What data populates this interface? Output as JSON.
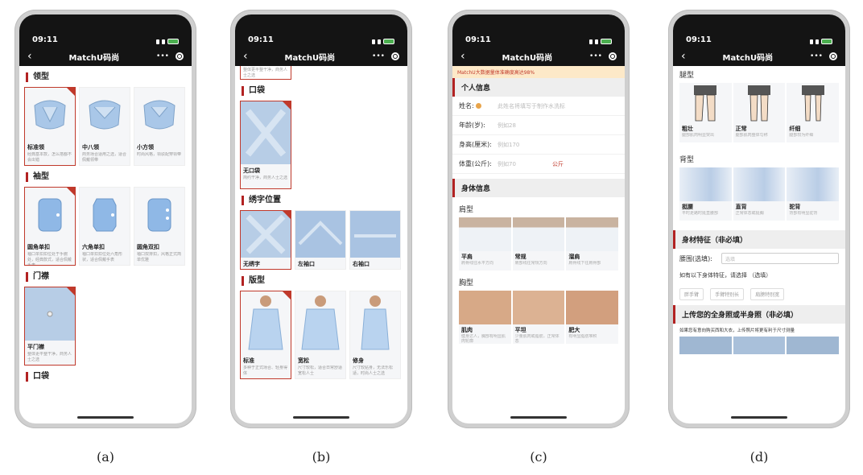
{
  "status": {
    "time": "09:11"
  },
  "nav": {
    "title": "MatchU码尚",
    "back": "‹",
    "more": "•••"
  },
  "captions": [
    "(a)",
    "(b)",
    "(c)",
    "(d)"
  ],
  "screen_a": {
    "sections": [
      {
        "title": "领型",
        "options": [
          {
            "name": "标准领",
            "desc": "经典基本款，怎么搭都不会出错",
            "selected": true
          },
          {
            "name": "中八领",
            "desc": "商务场合适用之选，适合佩戴领带",
            "selected": false
          },
          {
            "name": "小方领",
            "desc": "时尚风格，领驳配穿领带",
            "selected": false
          }
        ]
      },
      {
        "title": "袖型",
        "options": [
          {
            "name": "圆角单扣",
            "desc": "袖口单扣扣位处于手腕处，经典款式，适合佩戴手表",
            "selected": true
          },
          {
            "name": "六角单扣",
            "desc": "袖口单扣扣位处六角形状，适合佩戴手表",
            "selected": false
          },
          {
            "name": "圆角双扣",
            "desc": "袖口双排扣，风格正式简单优雅",
            "selected": false
          }
        ]
      },
      {
        "title": "门襟",
        "options": [
          {
            "name": "平门襟",
            "desc": "整体更平整干净，商务人士之选",
            "selected": true
          }
        ]
      }
    ],
    "last_title": "口袋"
  },
  "screen_b": {
    "top_desc": "整体更平整干净，商务人士之选",
    "sections": [
      {
        "title": "口袋",
        "options": [
          {
            "name": "无口袋",
            "desc": "简约干净，商务人士之选",
            "selected": true
          }
        ]
      },
      {
        "title": "绣字位置",
        "options": [
          {
            "name": "无绣字",
            "desc": "",
            "selected": true
          },
          {
            "name": "左袖口",
            "desc": "",
            "selected": false
          },
          {
            "name": "右袖口",
            "desc": "",
            "selected": false
          }
        ]
      },
      {
        "title": "版型",
        "options": [
          {
            "name": "标准",
            "desc": "多种于正式场合、轻身得体",
            "selected": true
          },
          {
            "name": "宽松",
            "desc": "尺寸较松，适合日常舒适宽松人士",
            "selected": false
          },
          {
            "name": "修身",
            "desc": "尺寸较贴身，无法乐松适，时尚人士之选",
            "selected": false
          }
        ]
      }
    ]
  },
  "screen_c": {
    "banner": "MatchU大数据量体准确度高达98%",
    "personal_title": "个人信息",
    "fields": [
      {
        "label": "姓名:",
        "placeholder": "此姓名将填写于制作水洗标",
        "unit": ""
      },
      {
        "label": "年龄(岁):",
        "placeholder": "例如28",
        "unit": ""
      },
      {
        "label": "身高(厘米):",
        "placeholder": "例如170",
        "unit": ""
      },
      {
        "label": "体重(公斤):",
        "placeholder": "例如70",
        "unit": "公斤"
      }
    ],
    "body_title": "身体信息",
    "shoulder": {
      "title": "肩型",
      "items": [
        {
          "name": "平肩",
          "desc": "肩骨线往水平方向"
        },
        {
          "name": "常规",
          "desc": "肩部线往常规方向"
        },
        {
          "name": "溜肩",
          "desc": "肩骨线下往肩骨部"
        }
      ]
    },
    "chest": {
      "title": "胸型",
      "items": [
        {
          "name": "肌肉",
          "desc": "健身达人，胸部有明显肌肉轮廓"
        },
        {
          "name": "平坦",
          "desc": "少量肌肉或脂肪，正常体态"
        },
        {
          "name": "肥大",
          "desc": "有明显脂肪堆积"
        }
      ]
    }
  },
  "screen_d": {
    "leg": {
      "title": "腿型",
      "items": [
        {
          "name": "粗壮",
          "desc": "腿部肌肉明显突出"
        },
        {
          "name": "正常",
          "desc": "腿部肌肉整体匀称"
        },
        {
          "name": "纤细",
          "desc": "腿部较为纤细"
        }
      ]
    },
    "back": {
      "title": "背型",
      "items": [
        {
          "name": "挺腰",
          "desc": "平时走路时挺直腰部"
        },
        {
          "name": "直背",
          "desc": "正常体态或挺胸"
        },
        {
          "name": "驼背",
          "desc": "背部有明显驼背"
        }
      ]
    },
    "figure_title": "身材特征（非必填）",
    "waist_label": "腰围(选填):",
    "waist_placeholder": "选填",
    "figure_hint": "如有以下身体特征，请选择 （选填）",
    "chips": [
      "胖手臂",
      "手臂特别长",
      "肩膀特别宽"
    ],
    "upload_title": "上传您的全身照或半身照（非必填）",
    "upload_hint": "如果您有意向购买西和大衣，上传照片将更有利于尺寸测量"
  }
}
